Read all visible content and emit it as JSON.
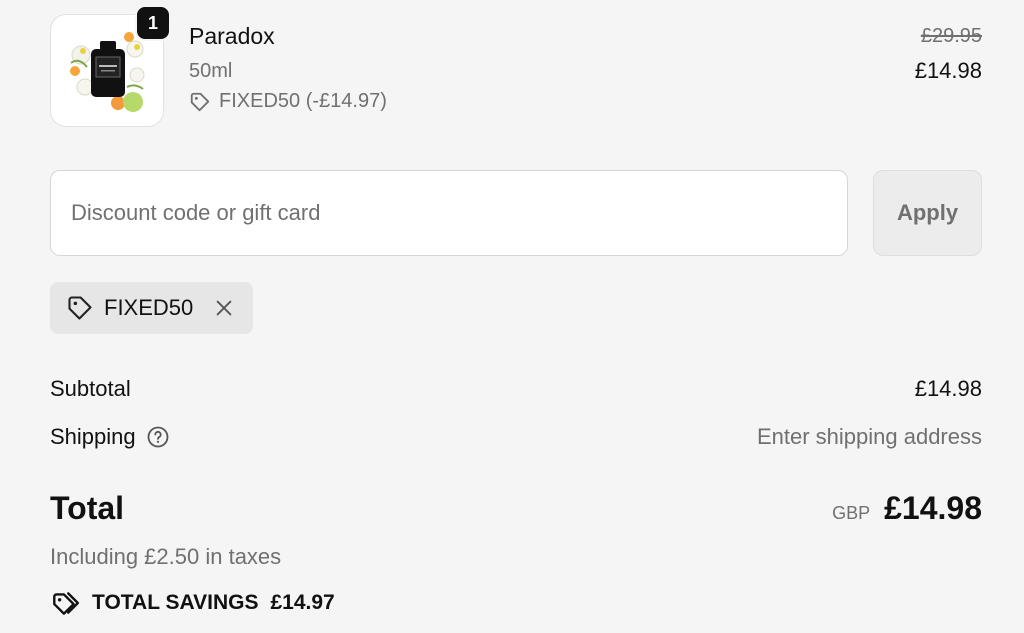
{
  "product": {
    "quantity": "1",
    "name": "Paradox",
    "variant": "50ml",
    "discount_line": "FIXED50 (-£14.97)",
    "original_price": "£29.95",
    "price": "£14.98",
    "image_icon": "perfume-bottle-icon"
  },
  "discount": {
    "placeholder": "Discount code or gift card",
    "value": "",
    "apply_label": "Apply",
    "applied_code": "FIXED50"
  },
  "summary": {
    "subtotal_label": "Subtotal",
    "subtotal_value": "£14.98",
    "shipping_label": "Shipping",
    "shipping_value": "Enter shipping address",
    "total_label": "Total",
    "currency": "GBP",
    "total_value": "£14.98",
    "taxes_note": "Including £2.50 in taxes",
    "savings_label": "TOTAL SAVINGS",
    "savings_value": "£14.97"
  },
  "icons": [
    "tag-icon",
    "close-icon",
    "question-circle-icon",
    "savings-tags-icon"
  ],
  "colors": {
    "background": "#f5f5f5",
    "text": "#111111",
    "muted": "#707070",
    "chip": "#e6e6e6"
  }
}
